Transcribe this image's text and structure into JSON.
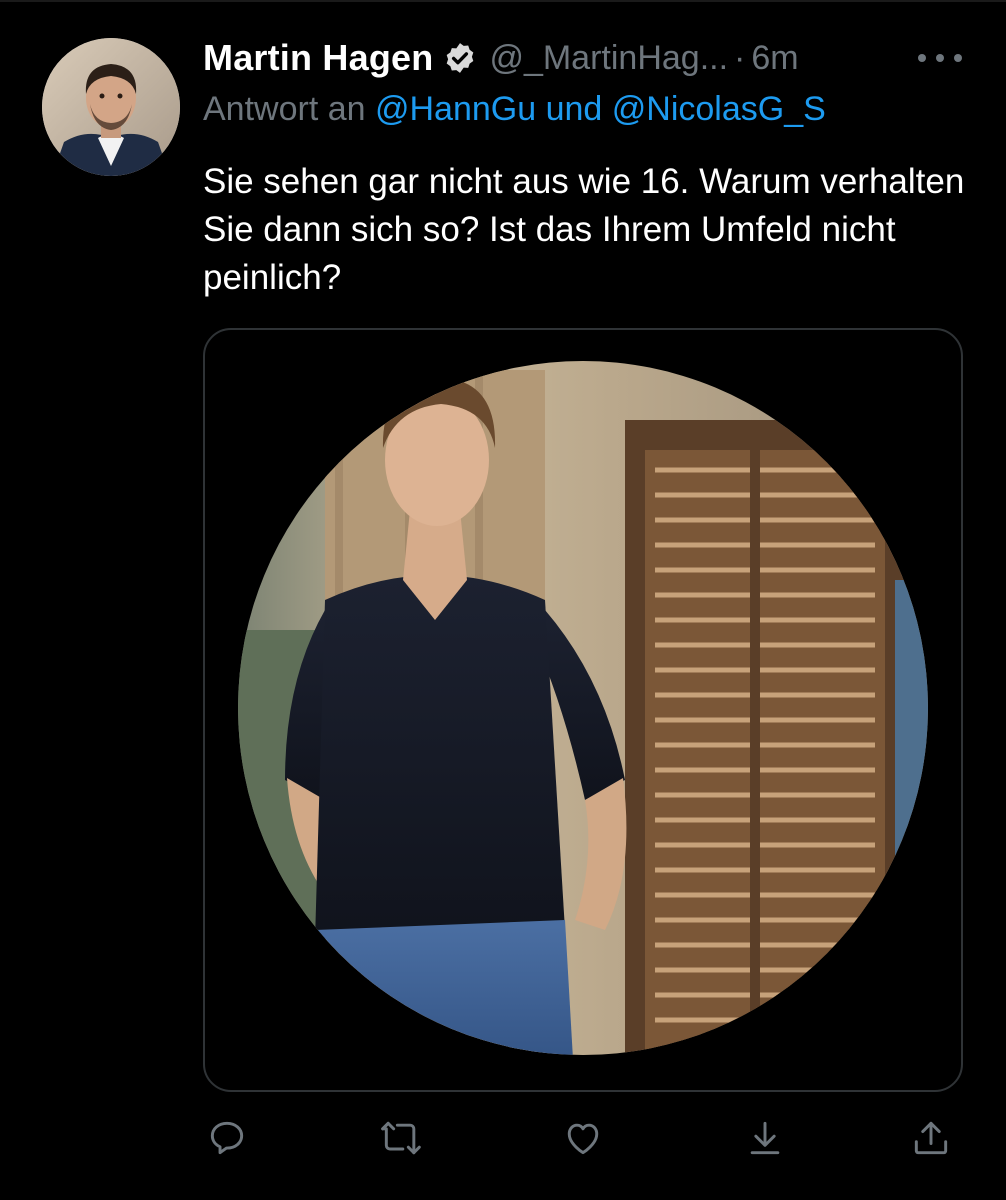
{
  "tweet": {
    "display_name": "Martin Hagen",
    "handle": "@_MartinHag...",
    "separator": "·",
    "time": "6m",
    "verified": true,
    "reply_prefix": "Antwort an",
    "reply_mentions": "@HannGu und @NicolasG_S",
    "text": "Sie sehen gar nicht aus wie 16. Warum verhalten Sie dann sich so? Ist das Ihrem Umfeld nicht peinlich?",
    "media": {
      "kind": "photo",
      "shape": "circle"
    }
  },
  "actions": [
    {
      "name": "reply",
      "icon": "reply-icon"
    },
    {
      "name": "retweet",
      "icon": "retweet-icon"
    },
    {
      "name": "like",
      "icon": "heart-icon"
    },
    {
      "name": "save",
      "icon": "download-icon"
    },
    {
      "name": "share",
      "icon": "share-icon"
    }
  ],
  "colors": {
    "background": "#000000",
    "primary_text": "#ffffff",
    "secondary_text": "#6e767d",
    "mention": "#1d9bf0",
    "card_border": "#2f3336"
  }
}
